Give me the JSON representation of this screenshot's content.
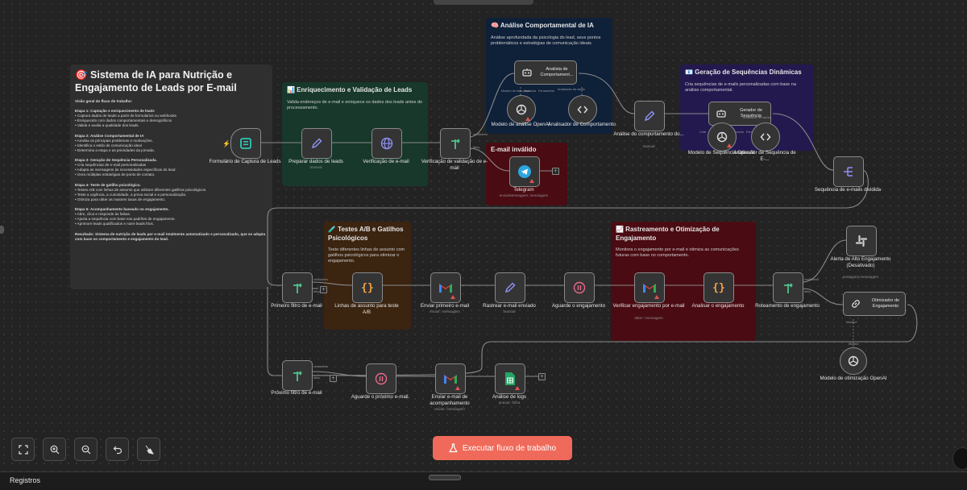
{
  "stickies": {
    "main": {
      "title": "🎯 Sistema de IA para Nutrição e Engajamento de Leads por E-mail",
      "lines": [
        "Visão geral do fluxo de trabalho:",
        "",
        "Etapa 1: Captação e enriquecimento de leads",
        "• Captura dados de leads a partir de formulários ou webhooks",
        "• Enriquecido com dados comportamentais e demográficos",
        "• Valida e avalia a qualidade dos leads.",
        "",
        "Etapa 2: Análise Comportamental de IA",
        "• Analisa os principais problemas e motivações.",
        "• Identifica o estilo de comunicação ideal",
        "• Determina a etapa e as prioridades da jornada.",
        "",
        "Etapa 3- Geração de Sequência Personalizada.",
        "• Cria sequências de e-mail personalizadas",
        "• Adapta as mensagens às necessidades específicas do lead.",
        "• Gera múltiplas estratégias de ponto de contato.",
        "",
        "Etapa 4- Teste de gatilho psicológico.",
        "• Testes A/B com linhas de assunto que utilizam diferentes gatilhos psicológicos.",
        "• Teste a urgência, a curiosidade, a prova social e a personalização.",
        "• Otimiza para obter as maiores taxas de engajamento.",
        "",
        "Etapa 5: Acompanhamento baseado no engajamento.",
        "• Abre, clica e responde às falsas.",
        "• Ajusta a sequência com base nos padrões de engajamento.",
        "• Aprimore leads qualificados e nutre leads frios.",
        "",
        "Resultado: Sistema de nutrição de leads por e-mail totalmente automatizado e personalizado, que se adapta com base no comportamento e engajamento do lead."
      ]
    },
    "enrich": {
      "title": "📊 Enriquecimento e Validação de Leads",
      "desc": "Valida endereços de e-mail e enriquece os dados dos leads antes do processamento."
    },
    "analysis": {
      "title": "🧠 Análise Comportamental de IA",
      "desc": "Análise aprofundada da psicologia do lead, seus pontos problemáticos e estratégias de comunicação ideais."
    },
    "invalid": {
      "title": "E-mail inválido"
    },
    "sequence": {
      "title": "📧 Geração de Sequências Dinâmicas",
      "desc": "Cria sequências de e-mails personalizadas com base na análise comportamental."
    },
    "ab": {
      "title": "🧪 Testes A/B e Gatilhos Psicológicos",
      "desc": "Teste diferentes linhas de assunto com gatilhos psicológicos para otimizar o engajamento."
    },
    "tracking": {
      "title": "📈 Rastreamento e Otimização de Engajamento",
      "desc": "Monitora o engajamento por e-mail e otimiza as comunicações futuras com base no comportamento."
    }
  },
  "nodes": {
    "form": {
      "label": "Formulário de Captura de Leads"
    },
    "prepare": {
      "label": "Preparar dados de leads",
      "sub": "manual"
    },
    "verify": {
      "label": "Verificação de e-mail"
    },
    "validate": {
      "label": "Verificação de validação de e-mail",
      "out_true": "verdadeiro",
      "out_false": "falso"
    },
    "telegram": {
      "label": "Telegram",
      "sub": "enviarMensagem: mensagem"
    },
    "analyst": {
      "label": "Analista de Comportament...",
      "ports": [
        "Modelo de bate-papo",
        "Memória",
        "Ferramenta",
        "Analisador de saída"
      ]
    },
    "openai1": {
      "label": "Modelo de análise OpenAI"
    },
    "parser1": {
      "label": "Analisador de Comportamento"
    },
    "behav": {
      "label": "Análise do comportamento do...",
      "sub": "manual"
    },
    "seqgen": {
      "label": "Gerador de Sequência",
      "ports": [
        "Chat",
        "Memória",
        "Ferramenta",
        "Analisador de saída"
      ]
    },
    "openai2": {
      "label": "Modelo de Sequência OpenAI"
    },
    "parser2": {
      "label": "Analisador de Sequência de E-..."
    },
    "split": {
      "label": "Sequência de e-mails dividida"
    },
    "filter1": {
      "label": "Primeiro filtro de e-mail",
      "out_true": "verdadeiro",
      "out_false": "falso"
    },
    "subjects": {
      "label": "Linhas de assunto para teste A/B"
    },
    "send1": {
      "label": "Enviar primeiro e-mail",
      "sub": "enviar: mensagem"
    },
    "track": {
      "label": "Rastrear e-mail enviado",
      "sub": "manual"
    },
    "wait1": {
      "label": "Aguarde o engajamento"
    },
    "check": {
      "label": "Verificar engajamento por e-mail",
      "sub": "obter: mensagem"
    },
    "analyze": {
      "label": "Analisar o engajamento"
    },
    "routing": {
      "label": "Roteamento de engajamento",
      "out_true": "verdadeiro",
      "out_false": "falso"
    },
    "slack": {
      "label": "Alerta de Alto Engajamento (Desativado)",
      "sub": "postagem:mensagem"
    },
    "optimizer": {
      "label": "Otimizador de Engajamento",
      "port": "Modelo*"
    },
    "openai3": {
      "label": "Modelo de otimização OpenAI",
      "port_top": "Modelo"
    },
    "filter2": {
      "label": "Próximo filtro de e-mail",
      "out_true": "verdadeiro",
      "out_false": "falso"
    },
    "wait2": {
      "label": "Aguarde o próximo e-mail."
    },
    "followup": {
      "label": "Enviar e-mail de acompanhamento",
      "sub": "enviar: mensagem"
    },
    "logs": {
      "label": "Análise de logs",
      "sub": "anexar: folha"
    }
  },
  "controls": {
    "fit": "fit-view",
    "zoom_in": "zoom-in",
    "zoom_out": "zoom-out",
    "undo": "undo",
    "tidy": "tidy-up"
  },
  "execute_button": "Executar fluxo de trabalho",
  "bottom": {
    "logs_label": "Registros"
  },
  "colors": {
    "green": "#17382a",
    "blue": "#0f2039",
    "red": "#4a0b12",
    "purple": "#23194f",
    "orange": "#3b2410",
    "gray": "#2f2f2f",
    "accent": "#ef6a5a"
  }
}
